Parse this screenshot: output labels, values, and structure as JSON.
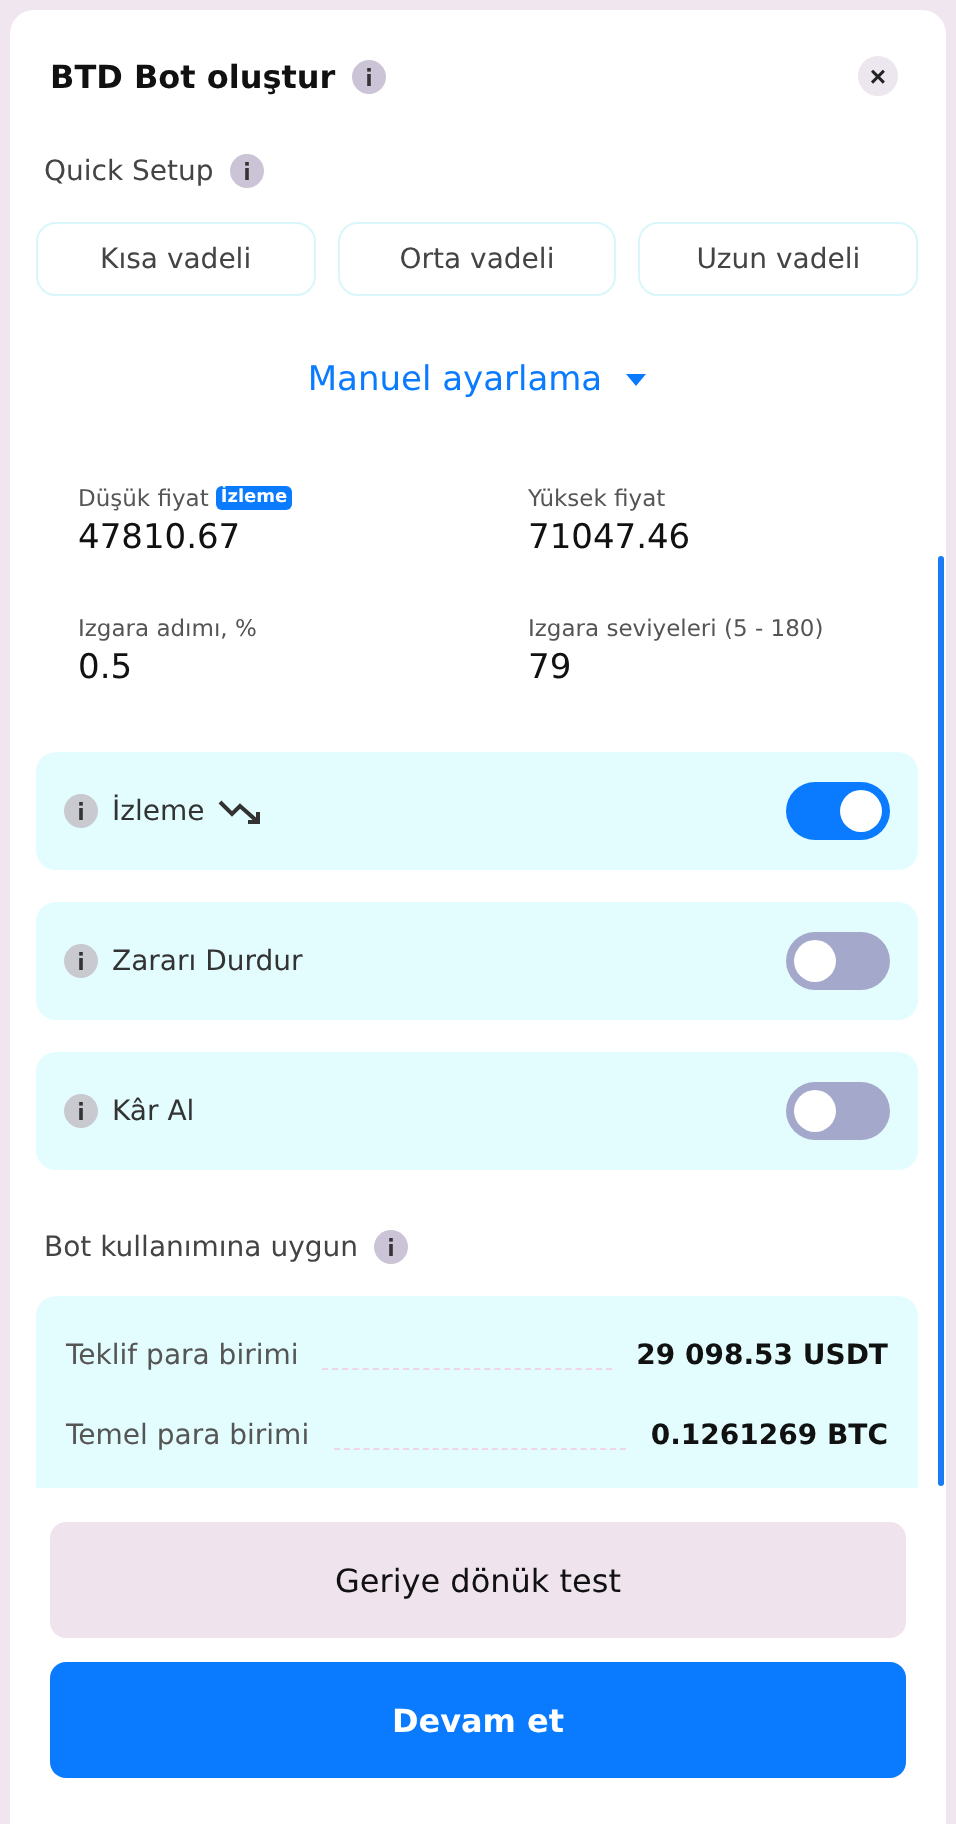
{
  "header": {
    "title": "BTD Bot oluştur",
    "close": "×"
  },
  "quick_setup": {
    "label": "Quick Setup",
    "presets": [
      {
        "label": "Kısa vadeli",
        "selected": false
      },
      {
        "label": "Orta vadeli",
        "selected": false
      },
      {
        "label": "Uzun vadeli",
        "selected": false
      }
    ]
  },
  "manual": {
    "label": "Manuel ayarlama",
    "expanded": true
  },
  "fields": [
    {
      "label": "Düşük fiyat",
      "badge": "İzleme",
      "value": "47810.67"
    },
    {
      "label": "Yüksek fiyat",
      "value": "71047.46"
    },
    {
      "label": "Izgara adımı, %",
      "value": "0.5"
    },
    {
      "label": "Izgara seviyeleri (5 - 180)",
      "value": "79"
    }
  ],
  "toggles": [
    {
      "label": "İzleme",
      "trend_icon": true,
      "on": true
    },
    {
      "label": "Zararı Durdur",
      "trend_icon": false,
      "on": false
    },
    {
      "label": "Kâr Al",
      "trend_icon": false,
      "on": false
    }
  ],
  "balances": {
    "label": "Bot kullanımına uygun",
    "rows": [
      {
        "name": "Teklif para birimi",
        "value": "29 098.53 USDT"
      },
      {
        "name": "Temel para birimi",
        "value": "0.1261269 BTC"
      }
    ]
  },
  "buttons": [
    {
      "label": "Geriye dönük test",
      "kind": "secondary"
    },
    {
      "label": "Devam et",
      "kind": "primary"
    }
  ]
}
